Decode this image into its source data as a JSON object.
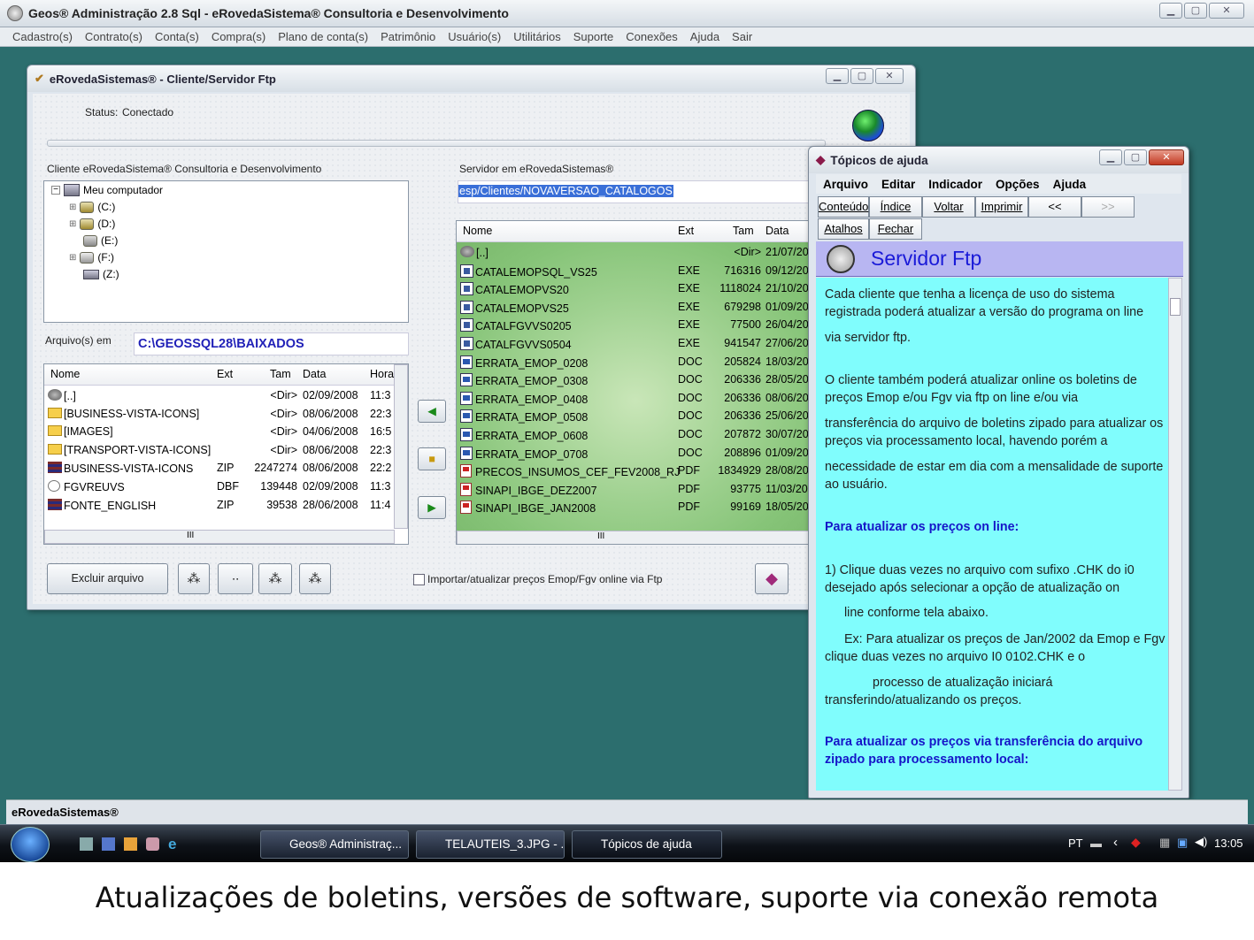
{
  "app": {
    "title": "Geos® Administração 2.8 Sql - eRovedaSistema® Consultoria e Desenvolvimento",
    "menu": [
      "Cadastro(s)",
      "Contrato(s)",
      "Conta(s)",
      "Compra(s)",
      "Plano de conta(s)",
      "Patrimônio",
      "Usuário(s)",
      "Utilitários",
      "Suporte",
      "Conexões",
      "Ajuda",
      "Sair"
    ],
    "statusbar": "eRovedaSistemas®"
  },
  "ftp": {
    "title": "eRovedaSistemas® - Cliente/Servidor Ftp",
    "status_label": "Status:",
    "status_value": "Conectado",
    "client_label": "Cliente eRovedaSistema® Consultoria e Desenvolvimento",
    "server_label": "Servidor em eRovedaSistemas®",
    "server_path": "esp/Clientes/NOVAVERSAO_CATALOGOS",
    "tree": [
      {
        "label": "Meu computador"
      },
      {
        "label": "(C:)"
      },
      {
        "label": "(D:)"
      },
      {
        "label": "(E:)"
      },
      {
        "label": "(F:)"
      },
      {
        "label": "(Z:)"
      }
    ],
    "files_in_label": "Arquivo(s) em",
    "files_in_path": "C:\\GEOSSQL28\\BAIXADOS",
    "local_headers": [
      "Nome",
      "Ext",
      "Tam",
      "Data",
      "Hora"
    ],
    "local_rows": [
      {
        "icon": "up",
        "name": "[..]",
        "ext": "",
        "size": "<Dir>",
        "date": "02/09/2008",
        "time": "11:3"
      },
      {
        "icon": "folder",
        "name": "[BUSINESS-VISTA-ICONS]",
        "ext": "",
        "size": "<Dir>",
        "date": "08/06/2008",
        "time": "22:3"
      },
      {
        "icon": "folder",
        "name": "[IMAGES]",
        "ext": "",
        "size": "<Dir>",
        "date": "04/06/2008",
        "time": "16:5"
      },
      {
        "icon": "folder",
        "name": "[TRANSPORT-VISTA-ICONS]",
        "ext": "",
        "size": "<Dir>",
        "date": "08/06/2008",
        "time": "22:3"
      },
      {
        "icon": "zip",
        "name": "BUSINESS-VISTA-ICONS",
        "ext": "ZIP",
        "size": "2247274",
        "date": "08/06/2008",
        "time": "22:2"
      },
      {
        "icon": "dbf",
        "name": "FGVREUVS",
        "ext": "DBF",
        "size": "139448",
        "date": "02/09/2008",
        "time": "11:3"
      },
      {
        "icon": "zip",
        "name": "FONTE_ENGLISH",
        "ext": "ZIP",
        "size": "39538",
        "date": "28/06/2008",
        "time": "11:4"
      }
    ],
    "remote_headers": [
      "Nome",
      "Ext",
      "Tam",
      "Data"
    ],
    "remote_rows": [
      {
        "icon": "up",
        "name": "[..]",
        "ext": "",
        "size": "<Dir>",
        "date": "21/07/20"
      },
      {
        "icon": "exe",
        "name": "CATALEMOPSQL_VS25",
        "ext": "EXE",
        "size": "716316",
        "date": "09/12/20"
      },
      {
        "icon": "exe",
        "name": "CATALEMOPVS20",
        "ext": "EXE",
        "size": "1118024",
        "date": "21/10/20"
      },
      {
        "icon": "exe",
        "name": "CATALEMOPVS25",
        "ext": "EXE",
        "size": "679298",
        "date": "01/09/20"
      },
      {
        "icon": "exe",
        "name": "CATALFGVVS0205",
        "ext": "EXE",
        "size": "77500",
        "date": "26/04/20"
      },
      {
        "icon": "exe",
        "name": "CATALFGVVS0504",
        "ext": "EXE",
        "size": "941547",
        "date": "27/06/20"
      },
      {
        "icon": "doc",
        "name": "ERRATA_EMOP_0208",
        "ext": "DOC",
        "size": "205824",
        "date": "18/03/20"
      },
      {
        "icon": "doc",
        "name": "ERRATA_EMOP_0308",
        "ext": "DOC",
        "size": "206336",
        "date": "28/05/20"
      },
      {
        "icon": "doc",
        "name": "ERRATA_EMOP_0408",
        "ext": "DOC",
        "size": "206336",
        "date": "08/06/20"
      },
      {
        "icon": "doc",
        "name": "ERRATA_EMOP_0508",
        "ext": "DOC",
        "size": "206336",
        "date": "25/06/20"
      },
      {
        "icon": "doc",
        "name": "ERRATA_EMOP_0608",
        "ext": "DOC",
        "size": "207872",
        "date": "30/07/20"
      },
      {
        "icon": "doc",
        "name": "ERRATA_EMOP_0708",
        "ext": "DOC",
        "size": "208896",
        "date": "01/09/20"
      },
      {
        "icon": "pdf",
        "name": "PRECOS_INSUMOS_CEF_FEV2008_RJ",
        "ext": "PDF",
        "size": "1834929",
        "date": "28/08/20"
      },
      {
        "icon": "pdf",
        "name": "SINAPI_IBGE_DEZ2007",
        "ext": "PDF",
        "size": "93775",
        "date": "11/03/20"
      },
      {
        "icon": "pdf",
        "name": "SINAPI_IBGE_JAN2008",
        "ext": "PDF",
        "size": "99169",
        "date": "18/05/20"
      }
    ],
    "scroll_mark": "III",
    "delete_button": "Excluir arquivo",
    "checkbox_label": "Importar/atualizar preços Emop/Fgv online via Ftp",
    "checkbox_checked": false
  },
  "help": {
    "title": "Tópicos de ajuda",
    "menu": [
      "Arquivo",
      "Editar",
      "Indicador",
      "Opções",
      "Ajuda"
    ],
    "buttons": [
      "Conteúdo",
      "Índice",
      "Voltar",
      "Imprimir",
      "<<",
      ">>",
      "Atalhos",
      "Fechar"
    ],
    "heading": "Servidor Ftp",
    "paragraphs": [
      {
        "text": "Cada cliente que tenha a licença de uso do sistema registrada poderá atualizar a versão do programa on line",
        "bold": false
      },
      {
        "text": "via servidor ftp.",
        "bold": false
      },
      {
        "text": "O cliente também poderá atualizar online os boletins de preços Emop e/ou Fgv via ftp on line e/ou via",
        "bold": false
      },
      {
        "text": "transferência do arquivo de boletins zipado para atualizar os preços via processamento local, havendo porém a",
        "bold": false
      },
      {
        "text": "necessidade  de estar em dia com a mensalidade de suporte ao usuário.",
        "bold": false
      },
      {
        "text": "Para atualizar os preços on line:",
        "bold": true
      },
      {
        "text": "1)  Clique duas vezes no arquivo com sufixo .CHK do i0 desejado após selecionar a opção de atualização on",
        "bold": false
      },
      {
        "text": "line conforme tela abaixo.",
        "bold": false
      },
      {
        "text": "Ex: Para atualizar os preços de Jan/2002 da Emop e Fgv clique duas vezes no arquivo I0 0102.CHK e o",
        "bold": false
      },
      {
        "text": "processo de atualização iniciará transferindo/atualizando os preços.",
        "bold": false
      },
      {
        "text": "Para atualizar os preços via transferência do arquivo zipado para processamento local:",
        "bold": true
      }
    ]
  },
  "taskbar": {
    "buttons": [
      "Geos® Administraç...",
      "TELAUTEIS_3.JPG - ...",
      "Tópicos de ajuda"
    ],
    "lang": "PT",
    "clock": "13:05"
  },
  "caption": "Atualizações de boletins, versões de software, suporte via conexão remota"
}
